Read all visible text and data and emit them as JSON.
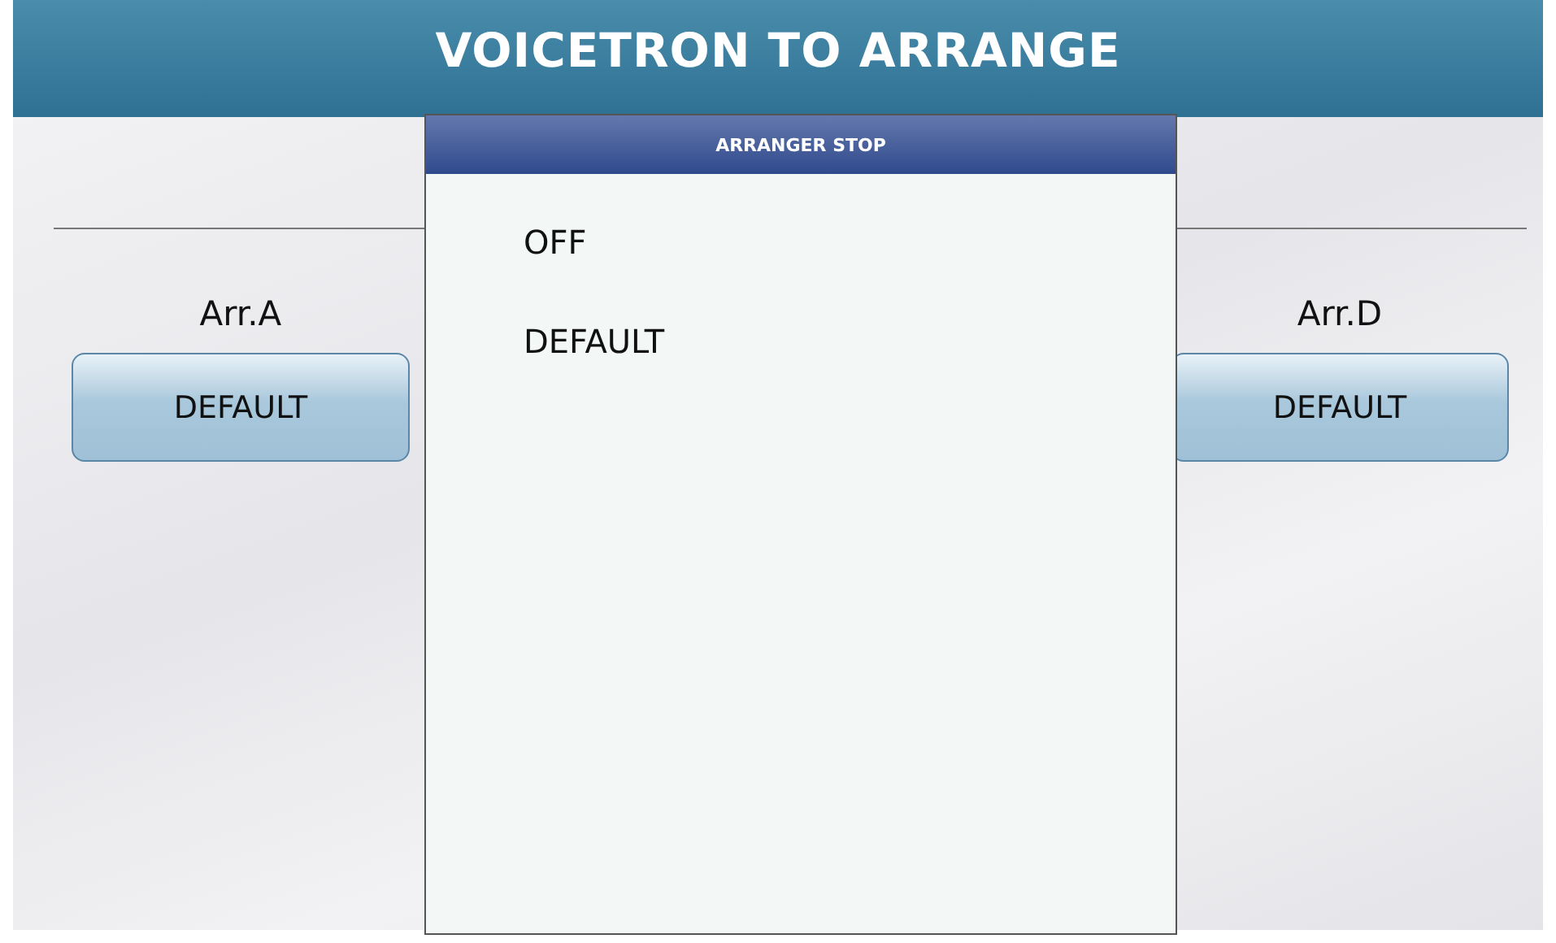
{
  "header": {
    "title": "VOICETRON TO ARRANGE"
  },
  "panels": [
    {
      "label": "Arr.A",
      "button": "DEFAULT"
    },
    {
      "label": "Arr.D",
      "button": "DEFAULT"
    }
  ],
  "popup": {
    "title": "ARRANGER STOP",
    "options": [
      {
        "label": "OFF"
      },
      {
        "label": "DEFAULT"
      }
    ]
  }
}
